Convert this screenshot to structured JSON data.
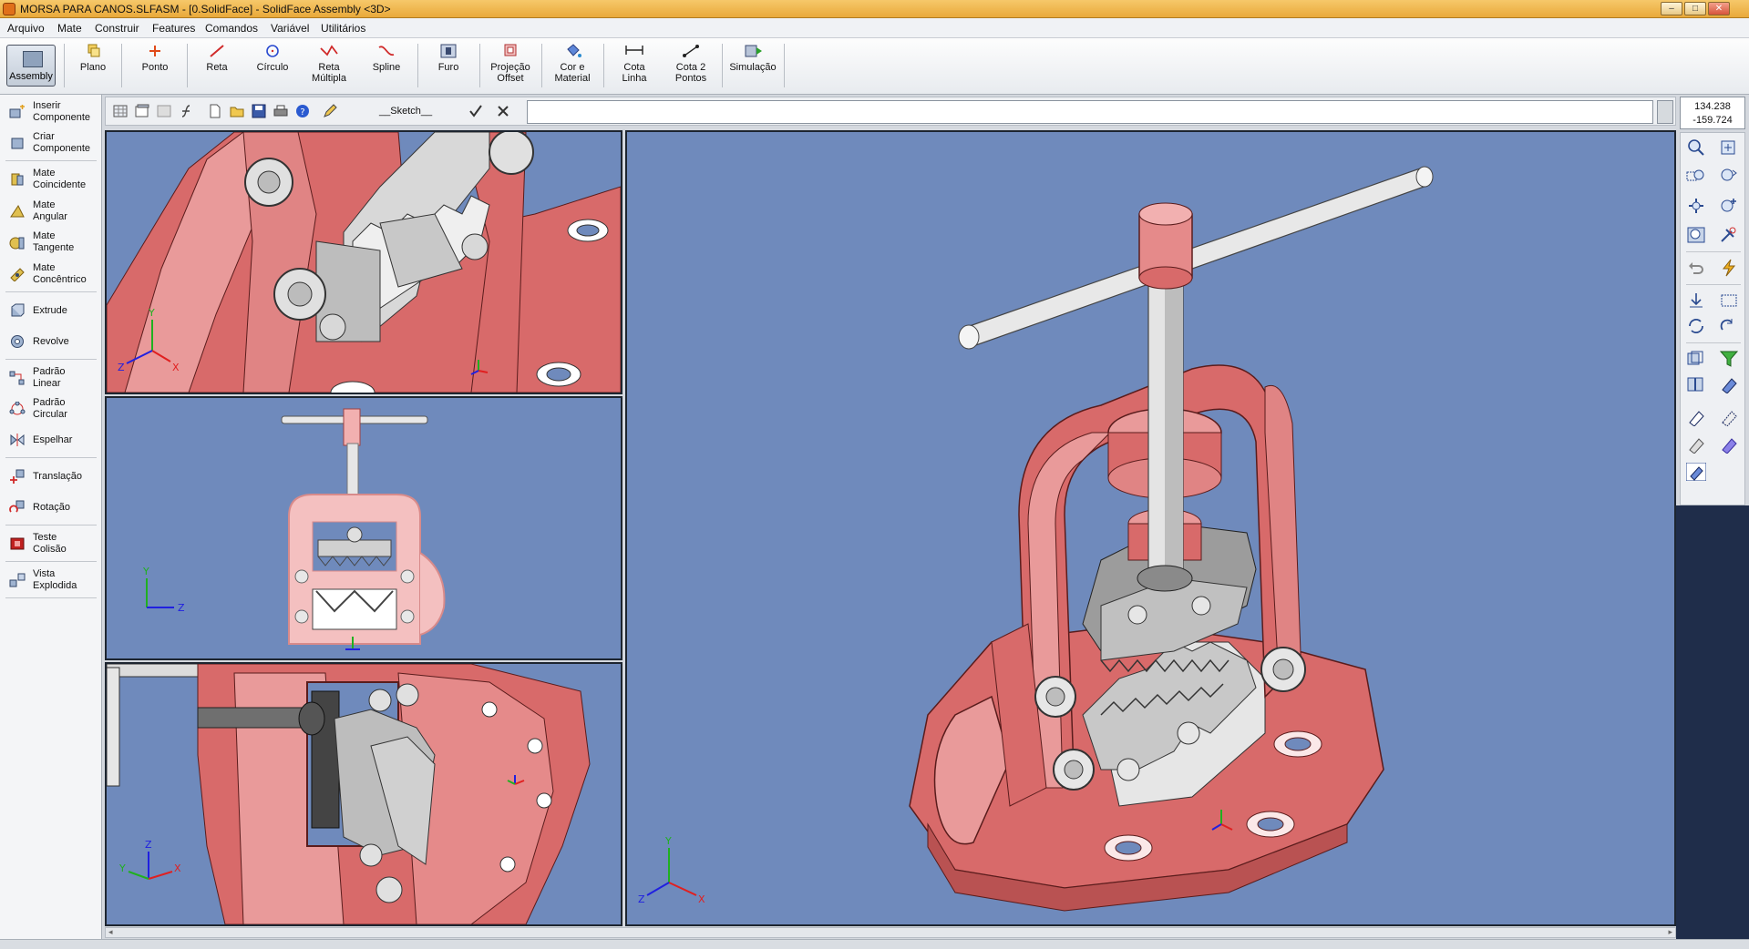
{
  "window": {
    "title": "MORSA PARA CANOS.SLFASM - [0.SolidFace] - SolidFace Assembly <3D>"
  },
  "menu": [
    "Arquivo",
    "Mate",
    "Construir",
    "Features",
    "Comandos",
    "Variável",
    "Utilitários"
  ],
  "ribbon": {
    "assembly": "Assembly",
    "tools": [
      {
        "l1": "Plano",
        "l2": ""
      },
      {
        "l1": "Ponto",
        "l2": ""
      },
      {
        "l1": "Reta",
        "l2": ""
      },
      {
        "l1": "Círculo",
        "l2": ""
      },
      {
        "l1": "Reta",
        "l2": "Múltipla"
      },
      {
        "l1": "Spline",
        "l2": ""
      },
      {
        "l1": "Furo",
        "l2": ""
      },
      {
        "l1": "Projeção",
        "l2": "Offset"
      },
      {
        "l1": "Cor e",
        "l2": "Material"
      },
      {
        "l1": "Cota",
        "l2": "Linha"
      },
      {
        "l1": "Cota 2",
        "l2": "Pontos"
      },
      {
        "l1": "Simulação",
        "l2": ""
      }
    ]
  },
  "left_panel": [
    {
      "l1": "Inserir",
      "l2": "Componente"
    },
    {
      "l1": "Criar",
      "l2": "Componente"
    },
    {
      "l1": "Mate",
      "l2": "Coincidente"
    },
    {
      "l1": "Mate",
      "l2": "Angular"
    },
    {
      "l1": "Mate",
      "l2": "Tangente"
    },
    {
      "l1": "Mate",
      "l2": "Concêntrico"
    },
    {
      "l1": "Extrude",
      "l2": ""
    },
    {
      "l1": "Revolve",
      "l2": ""
    },
    {
      "l1": "Padrão",
      "l2": "Linear"
    },
    {
      "l1": "Padrão",
      "l2": "Circular"
    },
    {
      "l1": "Espelhar",
      "l2": ""
    },
    {
      "l1": "Translação",
      "l2": ""
    },
    {
      "l1": "Rotação",
      "l2": ""
    },
    {
      "l1": "Teste",
      "l2": "Colisão"
    },
    {
      "l1": "Vista",
      "l2": "Explodida"
    }
  ],
  "sketch_bar": {
    "sketch_name": "__Sketch__",
    "command_value": ""
  },
  "coords": {
    "x": "134.238",
    "y": "-159.724"
  },
  "axes": {
    "x": "X",
    "y": "Y",
    "z": "Z"
  },
  "colors": {
    "viewport_bg": "#6f8abc",
    "part_red": "#d86a6a",
    "part_pink": "#e99a9a",
    "steel": "#d8d8d8",
    "jaw_dark": "#555555",
    "axis_x": "#e02020",
    "axis_y": "#20b020",
    "axis_z": "#2020e0"
  }
}
